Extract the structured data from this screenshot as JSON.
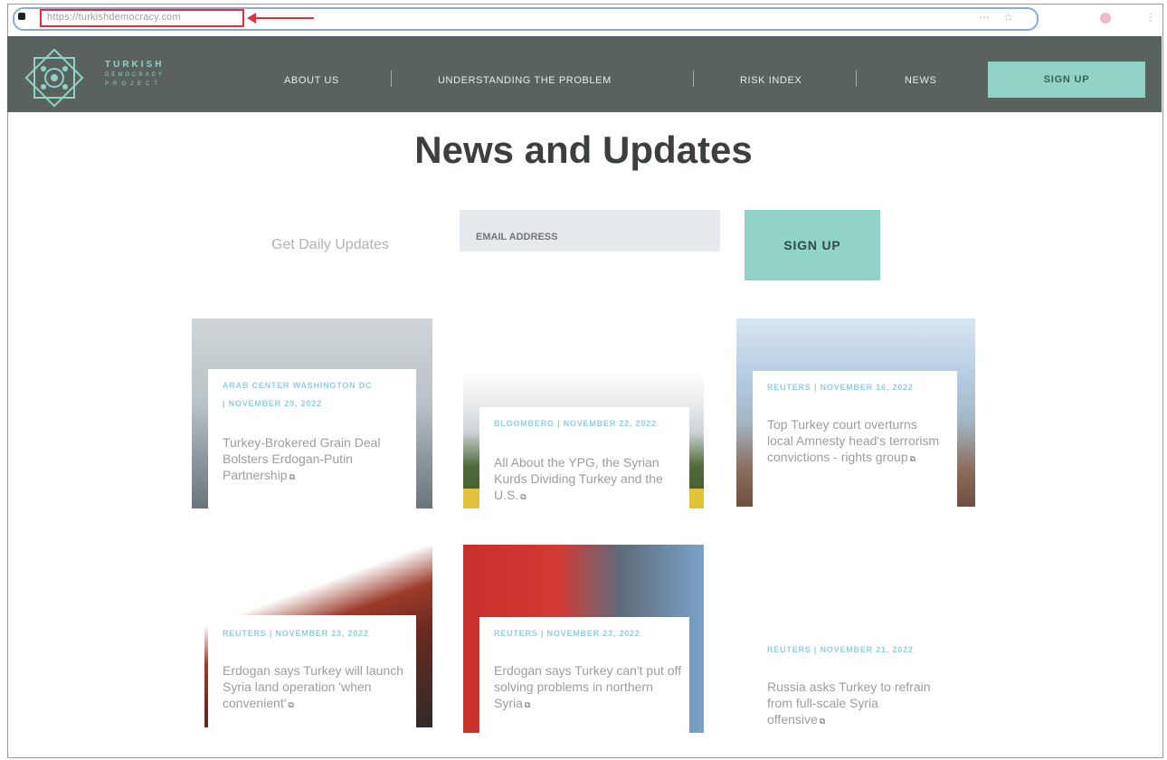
{
  "browser": {
    "url": "https://turkishdemocracy.com",
    "right_icons": "⋯ ☆"
  },
  "logo": {
    "line1": "TURKISH",
    "line2": "DEMOCRACY",
    "line3": "PROJECT"
  },
  "nav": {
    "about": "ABOUT US",
    "understanding": "UNDERSTANDING THE PROBLEM",
    "risk": "RISK INDEX",
    "news": "NEWS",
    "signup": "SIGN UP"
  },
  "hero": {
    "title": "News and Updates",
    "daily_label": "Get Daily Updates",
    "email_placeholder": "EMAIL ADDRESS",
    "signup": "SIGN UP"
  },
  "cards": [
    {
      "meta": "ARAB CENTER WASHINGTON DC | NOVEMBER 29, 2022",
      "title": "Turkey-Brokered Grain Deal Bolsters Erdogan-Putin Partnership"
    },
    {
      "meta": "BLOOMBERG | NOVEMBER 22, 2022",
      "title": "All About the YPG, the Syrian Kurds Dividing Turkey and the U.S."
    },
    {
      "meta": "REUTERS | NOVEMBER 16, 2022",
      "title": "Top Turkey court overturns local Amnesty head's terrorism convictions - rights group"
    },
    {
      "meta": "REUTERS | NOVEMBER 23, 2022",
      "title": "Erdogan says Turkey will launch Syria land operation 'when convenient'"
    },
    {
      "meta": "REUTERS | NOVEMBER 23, 2022",
      "title": "Erdogan says Turkey can't put off solving problems in northern Syria"
    },
    {
      "meta": "REUTERS | NOVEMBER 21, 2022",
      "title": "Russia asks Turkey to refrain from full-scale Syria offensive"
    }
  ],
  "colors": {
    "nav_bg": "#5a625f",
    "accent": "#92d3c8",
    "meta_blue": "#8fcfe0",
    "annotation_red": "#e0303c"
  }
}
